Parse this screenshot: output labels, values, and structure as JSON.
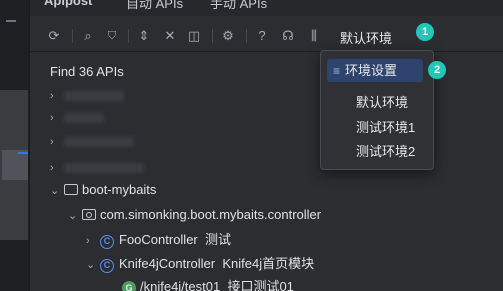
{
  "titlebar": {
    "app_name": "Apipost",
    "tab1": "自动 APIs",
    "tab2": "手动 APIs"
  },
  "toolbar": {
    "icons": [
      "refresh-icon",
      "search-icon",
      "filter-icon",
      "expand-icon",
      "collapse-icon",
      "split-icon",
      "settings-icon",
      "help-icon",
      "headset-icon",
      "sliders-icon"
    ],
    "env_label": "默认环境",
    "badge_1": "1"
  },
  "tree": {
    "find_label": "Find 36 APIs",
    "project": "boot-mybaits",
    "package": "com.simonking.boot.mybaits.controller",
    "class1_name": "FooController",
    "class1_desc": "测试",
    "class2_name": "Knife4jController",
    "class2_desc": "Knife4j首页模块",
    "method_path": "/knife4j/test01",
    "method_desc": "接口测试01",
    "method_badge": "G"
  },
  "dropdown": {
    "settings_label": "环境设置",
    "badge_2": "2",
    "items": [
      "默认环境",
      "测试环境1",
      "测试环境2"
    ]
  },
  "colors": {
    "accent": "#3574f0",
    "badge": "#21c7b8",
    "selected_bg": "#2e436e"
  }
}
